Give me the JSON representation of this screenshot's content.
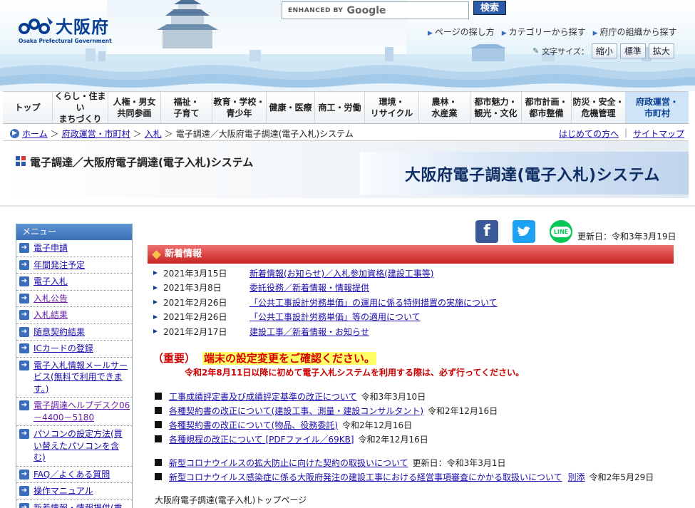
{
  "header": {
    "logo_text": "大阪府",
    "logo_en": "Osaka Prefectural Government",
    "search_enhanced": "ENHANCED BY",
    "search_google": "Google",
    "search_button": "検索",
    "top_links": [
      "ページの探し方",
      "カテゴリーから探す",
      "府庁の組織から探す"
    ],
    "text_size_label": "文字サイズ：",
    "text_size_buttons": [
      "縮小",
      "標準",
      "拡大"
    ]
  },
  "nav": {
    "items": [
      "トップ",
      "くらし・住まい\nまちづくり",
      "人権・男女\n共同参画",
      "福祉・\n子育て",
      "教育・学校・\n青少年",
      "健康・医療",
      "商工・労働",
      "環境・\nリサイクル",
      "農林・\n水産業",
      "都市魅力・\n観光・文化",
      "都市計画・\n都市整備",
      "防災・安全・\n危機管理",
      "府政運営・\n市町村"
    ],
    "active_index": 12
  },
  "breadcrumb": {
    "items": [
      "ホーム",
      "府政運営・市町村",
      "入札"
    ],
    "separator": "＞",
    "current": "電子調達／大阪府電子調達(電子入札)システム",
    "right_links": [
      "はじめての方へ",
      "サイトマップ"
    ]
  },
  "title": {
    "page_title": "電子調達／大阪府電子調達(電子入札)システム",
    "banner": "大阪府電子調達(電子入札)システム"
  },
  "sidebar": {
    "heading": "メニュー",
    "items": [
      {
        "label": "電子申請",
        "visited": false
      },
      {
        "label": "年間発注予定",
        "visited": false
      },
      {
        "label": "電子入札",
        "visited": false
      },
      {
        "label": "入札公告",
        "visited": true
      },
      {
        "label": "入札結果",
        "visited": true
      },
      {
        "label": "随意契約結果",
        "visited": false
      },
      {
        "label": "ICカードの登録",
        "visited": false
      },
      {
        "label": "電子入札情報メールサービス(無料で利用できます。)",
        "visited": false
      },
      {
        "label": "電子調達ヘルプデスク06－4400－5180",
        "visited": true
      },
      {
        "label": "パソコンの設定方法(買い替えたパソコンを含む)",
        "visited": false
      },
      {
        "label": "FAQ／よくある質問",
        "visited": false
      },
      {
        "label": "操作マニュアル",
        "visited": false
      },
      {
        "label": "新着情報・情報提供(重要なお知らせ)",
        "visited": false
      }
    ]
  },
  "main": {
    "social": {
      "facebook": "f",
      "twitter": "t",
      "line": "LINE"
    },
    "updated": "更新日：令和3年3月19日",
    "news_heading": "新着情報",
    "news": [
      {
        "date": "2021年3月15日",
        "text": "新着情報(お知らせ)／入札参加資格(建設工事等)"
      },
      {
        "date": "2021年3月8日",
        "text": "委託役務／新着情報・情報提供"
      },
      {
        "date": "2021年2月26日",
        "text": "「公共工事設計労務単価」の運用に係る特例措置の実施について"
      },
      {
        "date": "2021年2月26日",
        "text": "「公共工事設計労務単価」等の適用について"
      },
      {
        "date": "2021年2月17日",
        "text": "建設工事／新着情報・お知らせ"
      }
    ],
    "notice_important": "（重要）",
    "notice_message": "端末の設定変更をご確認ください。",
    "notice_sub": "令和2年8月11日以降に初めて電子入札システムを利用する際は、必ず行ってください。",
    "docs1": [
      {
        "text": "工事成績評定書及び成績評定基準の改正について",
        "date": "令和3年3月10日"
      },
      {
        "text": "各種契約書の改正について(建設工事、測量・建設コンサルタント)",
        "date": "令和2年12月16日"
      },
      {
        "text": "各種契約書の改正について(物品、役務委託)",
        "date": "令和2年12月16日"
      },
      {
        "text": "各種規程の改正について [PDFファイル／69KB]",
        "date": "令和2年12月16日"
      }
    ],
    "docs2": [
      {
        "text": "新型コロナウイルスの拡大防止に向けた契約の取扱いについて",
        "extra": "",
        "date": "更新日：令和3年3月1日"
      },
      {
        "text": "新型コロナウイルス感染症に係る大阪府発注の建設工事における経営事項審査にかかる取扱いについて",
        "extra": "別添",
        "date": "令和2年5月29日"
      }
    ],
    "footer": "大阪府電子調達(電子入札)トップページ"
  }
}
